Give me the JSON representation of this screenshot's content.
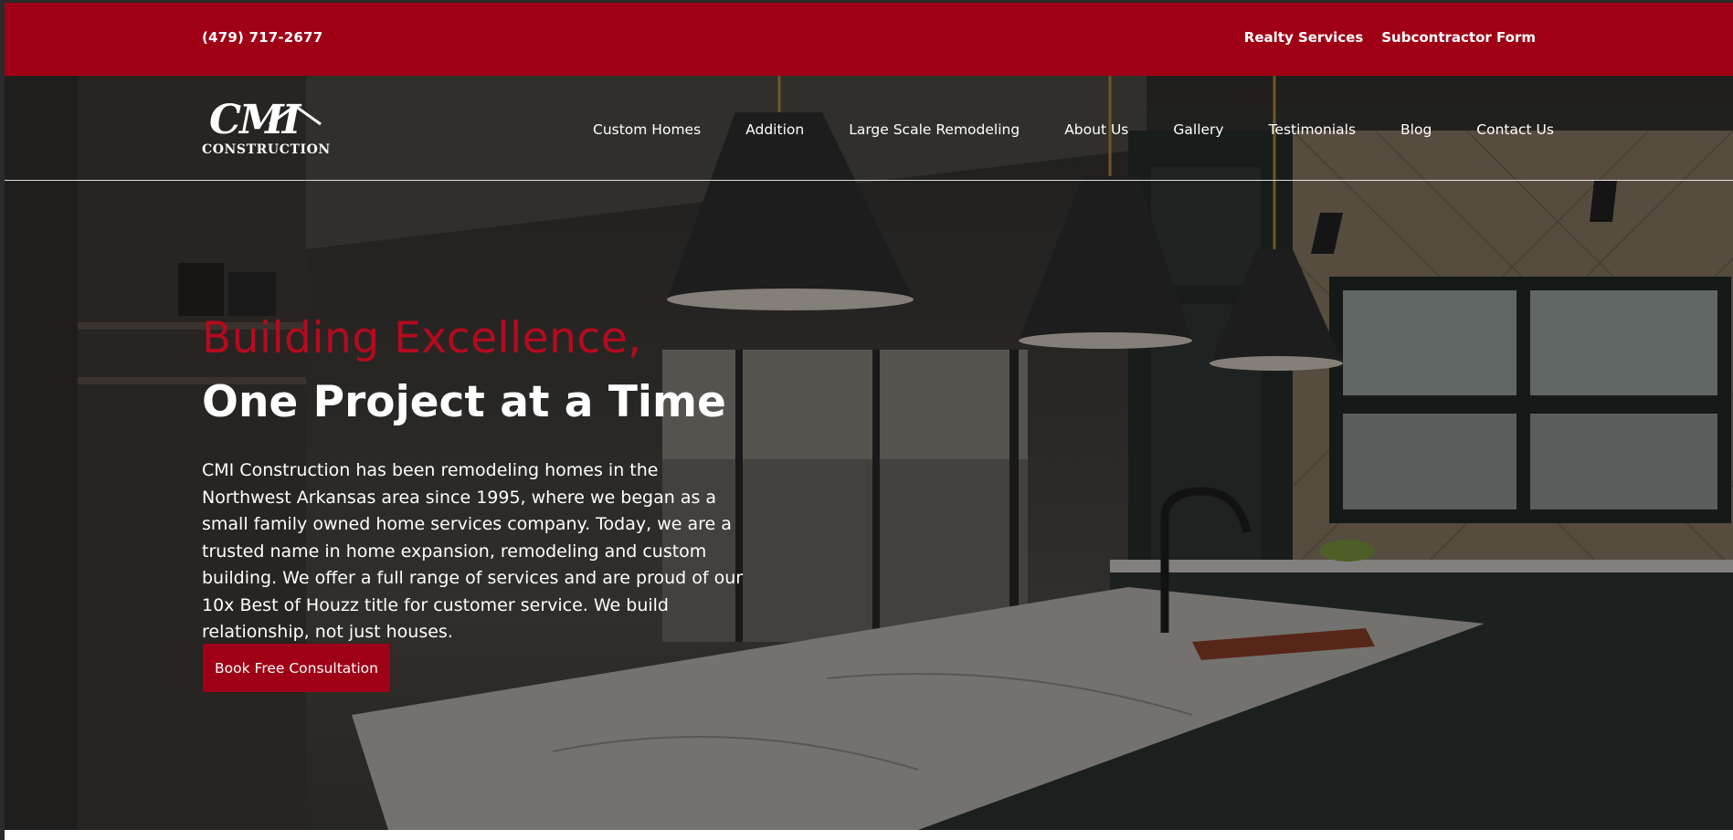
{
  "topbar": {
    "phone": "(479) 717-2677",
    "links": [
      "Realty Services",
      "Subcontractor Form"
    ],
    "color": "#a00016"
  },
  "logo": {
    "text_main": "CMI",
    "text_sub": "CONSTRUCTION"
  },
  "nav": {
    "items": [
      "Custom Homes",
      "Addition",
      "Large Scale Remodeling",
      "About Us",
      "Gallery",
      "Testimonials",
      "Blog",
      "Contact Us"
    ]
  },
  "hero": {
    "headline_accent": "Building Excellence,",
    "headline_main": "One Project at a Time",
    "description": "CMI Construction has been remodeling homes in the Northwest Arkansas area since 1995, where we began as a small family owned home services company. Today, we are a trusted name in home expansion, remodeling and custom building. We offer a full range of services and are proud of our 10x Best of Houzz title for customer service. We build relationship, not just houses.",
    "cta_label": "Book Free Consultation",
    "accent_color": "#b50a1e"
  }
}
